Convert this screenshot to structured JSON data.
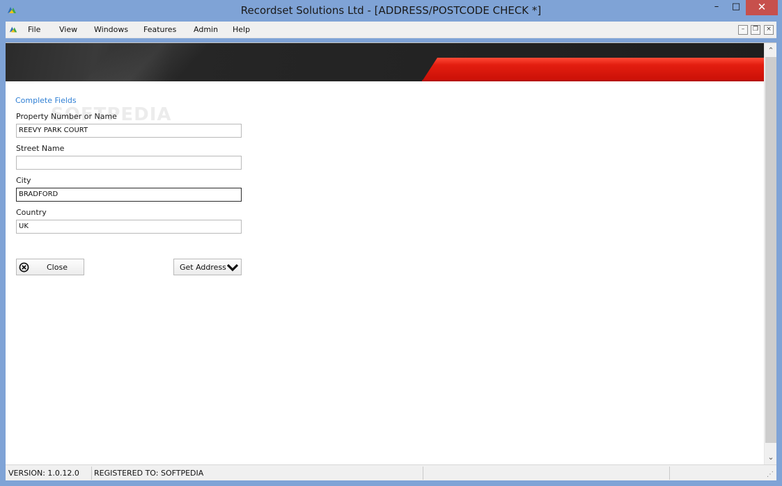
{
  "window": {
    "title": "Recordset Solutions Ltd - [ADDRESS/POSTCODE CHECK *]",
    "minimize_glyph": "–",
    "maximize_glyph": "□",
    "close_glyph": "✕"
  },
  "menu": {
    "items": [
      {
        "label": "File"
      },
      {
        "label": "View"
      },
      {
        "label": "Windows"
      },
      {
        "label": "Features"
      },
      {
        "label": "Admin"
      },
      {
        "label": "Help"
      }
    ],
    "mdi_minimize": "–",
    "mdi_restore": "❐",
    "mdi_close": "×"
  },
  "form": {
    "heading": "Complete Fields",
    "fields": [
      {
        "label": "Property Number or Name",
        "value": "REEVY PARK COURT"
      },
      {
        "label": "Street Name",
        "value": ""
      },
      {
        "label": "City",
        "value": "BRADFORD"
      },
      {
        "label": "Country",
        "value": "UK"
      }
    ],
    "close_button": "Close",
    "get_address_button": "Get Address",
    "watermark": "SOFTPEDIA"
  },
  "statusbar": {
    "version": "VERSION: 1.0.12.0",
    "registered": "REGISTERED TO: SOFTPEDIA"
  },
  "colors": {
    "accent_red": "#e31e10",
    "link_blue": "#2f7fd4",
    "titlebar": "#7fa3d6",
    "close_button": "#c7504c"
  },
  "icons": {
    "app": "app-logo-icon",
    "close": "circle-x-icon",
    "get_address": "chevron-down-icon"
  }
}
